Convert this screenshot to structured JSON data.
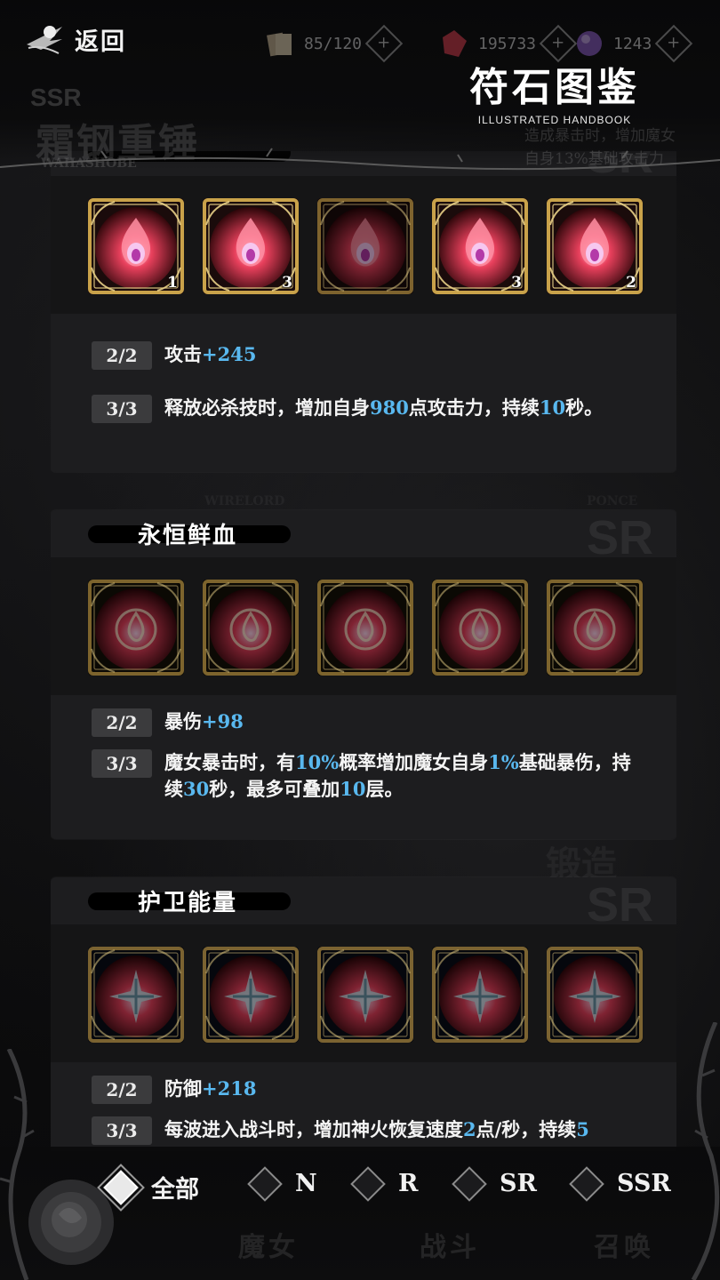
{
  "header": {
    "back_label": "返回",
    "resources": [
      {
        "icon": "card-stack-icon",
        "value": "85/120"
      },
      {
        "icon": "red-crystal-icon",
        "value": "195733"
      },
      {
        "icon": "purple-orb-icon",
        "value": "1243"
      }
    ],
    "title": "符石图鉴",
    "subtitle": "ILLUSTRATED HANDBOOK"
  },
  "background": {
    "ssr_tag": "SSR",
    "hero_name": "霜钢重锤",
    "hero_name_en": "WAHASHOBE",
    "hero_desc_1": "造成暴击时，增加魔女",
    "hero_desc_2": "自身13%基础攻击力"
  },
  "rune_sets": [
    {
      "name": "",
      "rank": "SR",
      "gem": "red-flame-gem-icon",
      "runes": [
        {
          "count": "1",
          "dim": false
        },
        {
          "count": "3",
          "dim": false
        },
        {
          "count": "",
          "dim": true
        },
        {
          "count": "3",
          "dim": false
        },
        {
          "count": "2",
          "dim": false
        }
      ],
      "effects": [
        {
          "tier": "2/2",
          "parts": [
            {
              "t": "攻击"
            },
            {
              "t": "+245",
              "hl": true
            }
          ]
        },
        {
          "tier": "3/3",
          "parts": [
            {
              "t": "释放必杀技时，增加自身"
            },
            {
              "t": "980",
              "hl": true
            },
            {
              "t": "点攻击力，持续"
            },
            {
              "t": "10",
              "hl": true
            },
            {
              "t": "秒。"
            }
          ]
        }
      ]
    },
    {
      "name": "永恒鲜血",
      "rank": "SR",
      "gem": "golden-drop-gem-icon",
      "runes": [
        {
          "count": "",
          "dim": true
        },
        {
          "count": "",
          "dim": true
        },
        {
          "count": "",
          "dim": true
        },
        {
          "count": "",
          "dim": true
        },
        {
          "count": "",
          "dim": true
        }
      ],
      "effects": [
        {
          "tier": "2/2",
          "parts": [
            {
              "t": "暴伤"
            },
            {
              "t": "+98",
              "hl": true
            }
          ]
        },
        {
          "tier": "3/3",
          "parts": [
            {
              "t": "魔女暴击时，有"
            },
            {
              "t": "10%",
              "hl": true
            },
            {
              "t": "概率增加魔女自身"
            },
            {
              "t": "1%",
              "hl": true
            },
            {
              "t": "基础暴伤，持续"
            },
            {
              "t": "30",
              "hl": true
            },
            {
              "t": "秒，最多可叠加"
            },
            {
              "t": "10",
              "hl": true
            },
            {
              "t": "层。"
            }
          ]
        }
      ]
    },
    {
      "name": "护卫能量",
      "rank": "SR",
      "gem": "blue-crest-gem-icon",
      "runes": [
        {
          "count": "",
          "dim": true
        },
        {
          "count": "",
          "dim": true
        },
        {
          "count": "",
          "dim": true
        },
        {
          "count": "",
          "dim": true
        },
        {
          "count": "",
          "dim": true
        }
      ],
      "effects": [
        {
          "tier": "2/2",
          "parts": [
            {
              "t": "防御"
            },
            {
              "t": "+218",
              "hl": true
            }
          ]
        },
        {
          "tier": "3/3",
          "parts": [
            {
              "t": "每波进入战斗时，增加神火恢复速度"
            },
            {
              "t": "2",
              "hl": true
            },
            {
              "t": "点/秒，持续"
            },
            {
              "t": "5",
              "hl": true
            }
          ]
        }
      ]
    }
  ],
  "filters": [
    {
      "label": "全部",
      "active": true
    },
    {
      "label": "N",
      "active": false
    },
    {
      "label": "R",
      "active": false
    },
    {
      "label": "SR",
      "active": false
    },
    {
      "label": "SSR",
      "active": false
    }
  ],
  "ghost_tabs": [
    "魔女",
    "战斗",
    "召唤"
  ],
  "colors": {
    "highlight": "#59b8ef",
    "gold": "#c9a24a",
    "card_bg": "#1d1d1f"
  }
}
